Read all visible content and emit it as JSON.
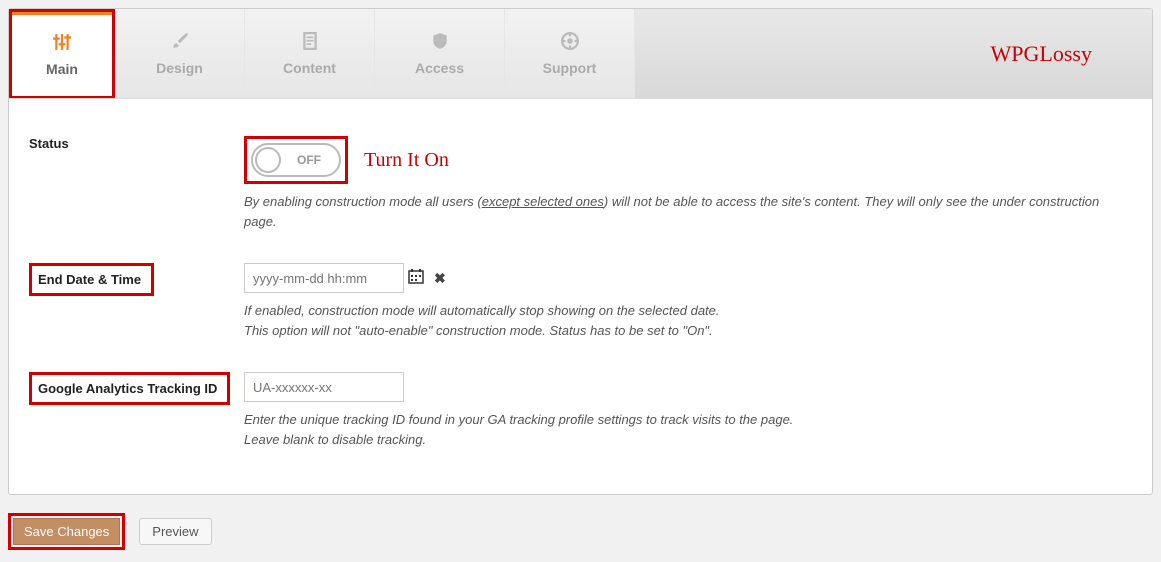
{
  "tabs": {
    "main": "Main",
    "design": "Design",
    "content": "Content",
    "access": "Access",
    "support": "Support"
  },
  "brand": "WPGLossy",
  "fields": {
    "status": {
      "label": "Status",
      "toggle_label": "OFF",
      "annotation": "Turn It On",
      "desc_a": "By enabling construction mode all users (",
      "desc_link": "except selected ones",
      "desc_b": ") will not be able to access the site's content. They will only see the under construction page."
    },
    "enddate": {
      "label": "End Date & Time",
      "placeholder": "yyyy-mm-dd hh:mm",
      "desc_a": "If enabled, construction mode will automatically stop showing on the selected date.",
      "desc_b": "This option will not \"auto-enable\" construction mode. Status has to be set to \"On\"."
    },
    "ga": {
      "label": "Google Analytics Tracking ID",
      "placeholder": "UA-xxxxxx-xx",
      "desc_a": "Enter the unique tracking ID found in your GA tracking profile settings to track visits to the page.",
      "desc_b": "Leave blank to disable tracking."
    }
  },
  "buttons": {
    "save": "Save Changes",
    "preview": "Preview"
  }
}
